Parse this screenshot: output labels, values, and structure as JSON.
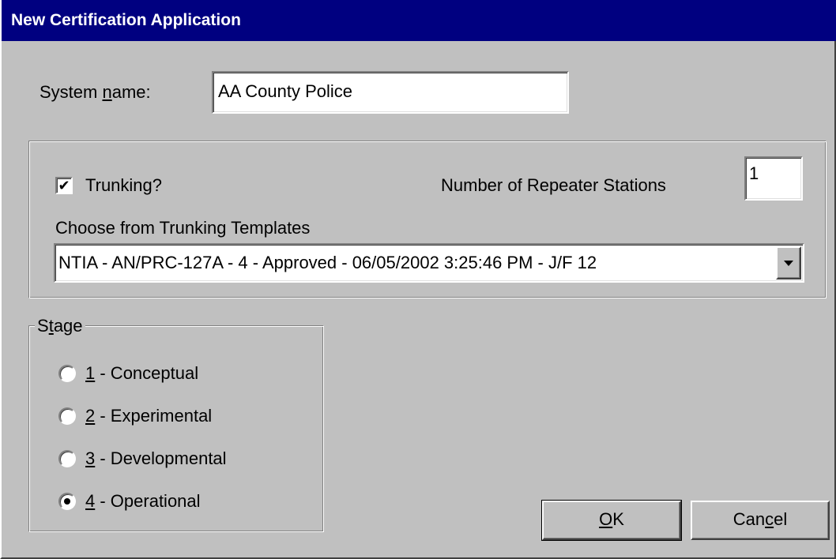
{
  "dialog": {
    "title": "New Certification Application"
  },
  "system_name": {
    "label_pre": "System ",
    "label_ul": "n",
    "label_post": "ame:",
    "value": "AA County Police"
  },
  "trunking": {
    "checkbox_label": "Trunking?",
    "checked": true,
    "check_glyph": "✔",
    "repeater_label": "Number of Repeater Stations",
    "repeater_value": "1",
    "template_label": "Choose from Trunking Templates",
    "template_selected": "NTIA - AN/PRC-127A - 4 - Approved - 06/05/2002 3:25:46 PM - J/F 12"
  },
  "stage": {
    "legend_pre": "S",
    "legend_ul": "t",
    "legend_post": "age",
    "options": [
      {
        "key": "1",
        "text": " - Conceptual",
        "selected": false
      },
      {
        "key": "2",
        "text": " - Experimental",
        "selected": false
      },
      {
        "key": "3",
        "text": " - Developmental",
        "selected": false
      },
      {
        "key": "4",
        "text": " - Operational",
        "selected": true
      }
    ]
  },
  "buttons": {
    "ok_ul": "O",
    "ok_post": "K",
    "cancel_pre": "Can",
    "cancel_ul": "c",
    "cancel_post": "el"
  }
}
